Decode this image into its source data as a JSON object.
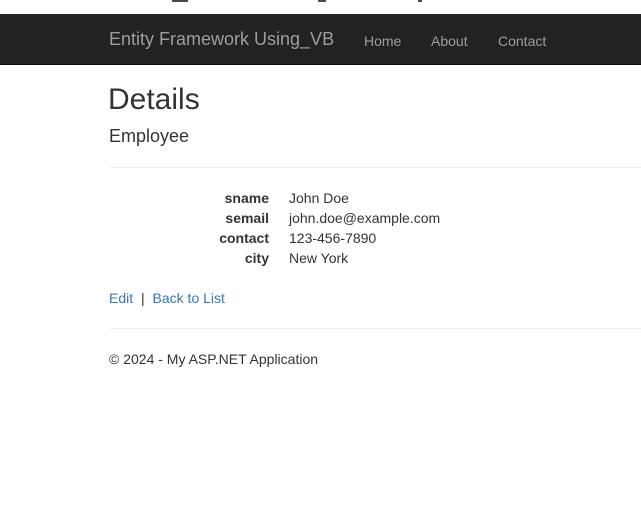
{
  "navbar": {
    "brand": "Entity Framework Using_VB",
    "links": [
      "Home",
      "About",
      "Contact"
    ]
  },
  "page": {
    "title": "Details",
    "subtitle": "Employee"
  },
  "details": [
    {
      "label": "sname",
      "value": "John Doe"
    },
    {
      "label": "semail",
      "value": "john.doe@example.com"
    },
    {
      "label": "contact",
      "value": "123-456-7890"
    },
    {
      "label": "city",
      "value": "New York"
    }
  ],
  "actions": {
    "edit": "Edit",
    "separator": "|",
    "back": "Back to List"
  },
  "footer": {
    "text": "© 2024 - My ASP.NET Application"
  }
}
